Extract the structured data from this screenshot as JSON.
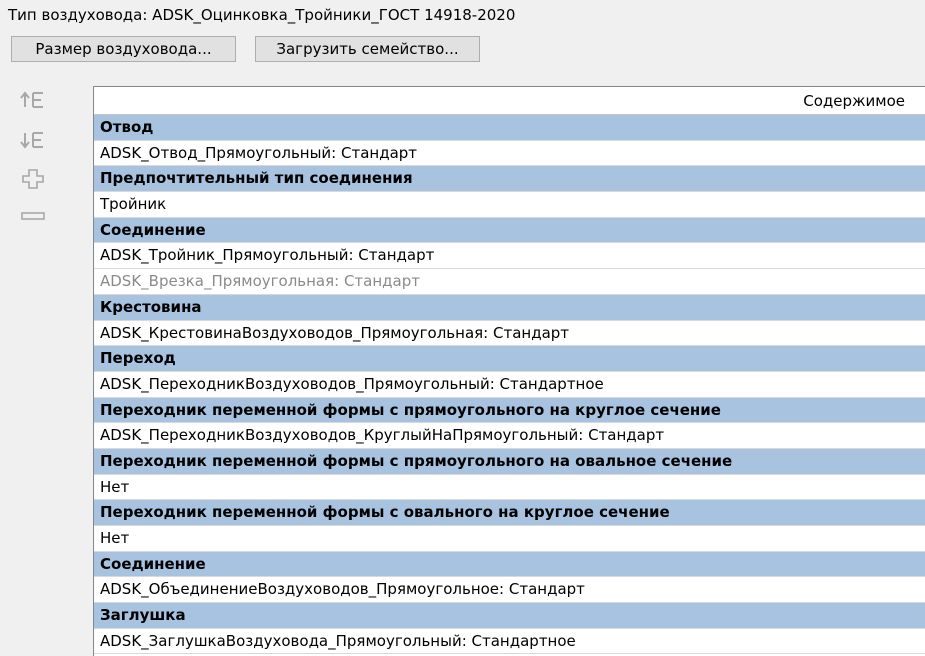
{
  "title": "Тип воздуховода: ADSK_Оцинковка_Тройники_ГОСТ 14918-2020",
  "buttons": {
    "size": "Размер воздуховода...",
    "load_family": "Загрузить семейство..."
  },
  "side_tools": [
    {
      "name": "move-up-icon"
    },
    {
      "name": "move-down-icon"
    },
    {
      "name": "add-icon"
    },
    {
      "name": "remove-icon"
    }
  ],
  "table": {
    "header": "Содержимое",
    "rows": [
      {
        "type": "group",
        "text": "Отвод"
      },
      {
        "type": "item",
        "text": "ADSK_Отвод_Прямоугольный: Стандарт"
      },
      {
        "type": "group",
        "text": "Предпочтительный тип соединения"
      },
      {
        "type": "item",
        "text": "Тройник"
      },
      {
        "type": "group",
        "text": "Соединение"
      },
      {
        "type": "item",
        "text": "ADSK_Тройник_Прямоугольный: Стандарт"
      },
      {
        "type": "item-muted",
        "text": "ADSK_Врезка_Прямоугольная: Стандарт"
      },
      {
        "type": "group",
        "text": "Крестовина"
      },
      {
        "type": "item",
        "text": "ADSK_КрестовинаВоздуховодов_Прямоугольная: Стандарт"
      },
      {
        "type": "group",
        "text": "Переход"
      },
      {
        "type": "item",
        "text": "ADSK_ПереходникВоздуховодов_Прямоугольный: Стандартное"
      },
      {
        "type": "group",
        "text": "Переходник переменной формы с прямоугольного на круглое сечение"
      },
      {
        "type": "item",
        "text": "ADSK_ПереходникВоздуховодов_КруглыйНаПрямоугольный: Стандарт"
      },
      {
        "type": "group",
        "text": "Переходник переменной формы с прямоугольного на овальное сечение"
      },
      {
        "type": "item",
        "text": "Нет"
      },
      {
        "type": "group",
        "text": "Переходник переменной формы с овального на круглое сечение"
      },
      {
        "type": "item",
        "text": "Нет"
      },
      {
        "type": "group",
        "text": "Соединение"
      },
      {
        "type": "item",
        "text": "ADSK_ОбъединениеВоздуховодов_Прямоугольное: Стандарт"
      },
      {
        "type": "group",
        "text": "Заглушка"
      },
      {
        "type": "item",
        "text": "ADSK_ЗаглушкаВоздуховода_Прямоугольный: Стандартное"
      }
    ]
  }
}
